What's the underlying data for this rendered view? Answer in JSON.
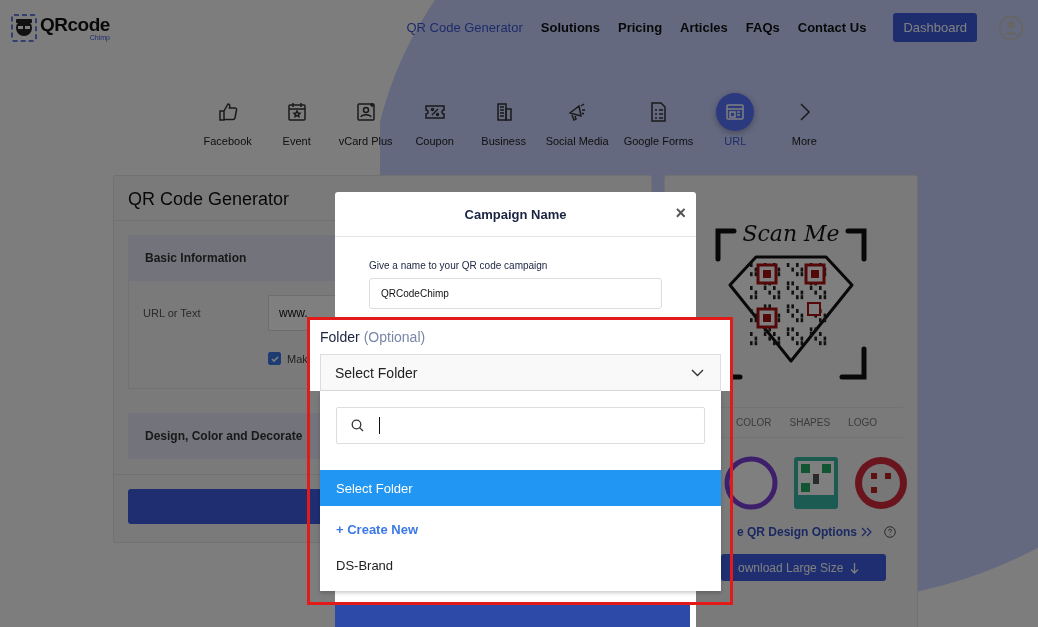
{
  "header": {
    "logo": {
      "name": "QRcode",
      "tagline": "Chimp"
    },
    "nav": [
      {
        "label": "QR Code Generator",
        "selected": true
      },
      {
        "label": "Solutions",
        "selected": false
      },
      {
        "label": "Pricing",
        "selected": false
      },
      {
        "label": "Articles",
        "selected": false
      },
      {
        "label": "FAQs",
        "selected": false
      },
      {
        "label": "Contact Us",
        "selected": false
      }
    ],
    "dashboard_button": "Dashboard"
  },
  "qr_types": [
    {
      "label": "Facebook",
      "selected": false
    },
    {
      "label": "Event",
      "selected": false
    },
    {
      "label": "vCard Plus",
      "selected": false
    },
    {
      "label": "Coupon",
      "selected": false
    },
    {
      "label": "Business",
      "selected": false
    },
    {
      "label": "Social Media",
      "selected": false
    },
    {
      "label": "Google Forms",
      "selected": false
    },
    {
      "label": "URL",
      "selected": true
    },
    {
      "label": "More",
      "selected": false
    }
  ],
  "generator": {
    "title": "QR Code Generator",
    "basic_section": "Basic Information",
    "url_label": "URL or Text",
    "url_value": "www.",
    "checkbox": {
      "label": "Mak",
      "checked": true
    },
    "design_section": "Design, Color and Decorate"
  },
  "preview": {
    "frame_text": "Scan Me",
    "tabs": [
      {
        "label": "COLOR",
        "selected": false
      },
      {
        "label": "SHAPES",
        "selected": false
      },
      {
        "label": "LOGO",
        "selected": false
      }
    ],
    "more_link": "e QR Design Options",
    "download_button": "ownload Large Size"
  },
  "modal": {
    "title": "Campaign Name",
    "close": "×",
    "name_label": "Give a name to your QR code campaign",
    "name_value": "QRCodeChimp"
  },
  "folder_dropdown": {
    "label": "Folder",
    "hint": "(Optional)",
    "value": "Select Folder",
    "options": [
      {
        "label": "Select Folder",
        "kind": "option",
        "selected": true
      },
      {
        "label": "+ Create New",
        "kind": "action",
        "selected": false
      },
      {
        "label": "DS-Brand",
        "kind": "option",
        "selected": false
      }
    ]
  }
}
